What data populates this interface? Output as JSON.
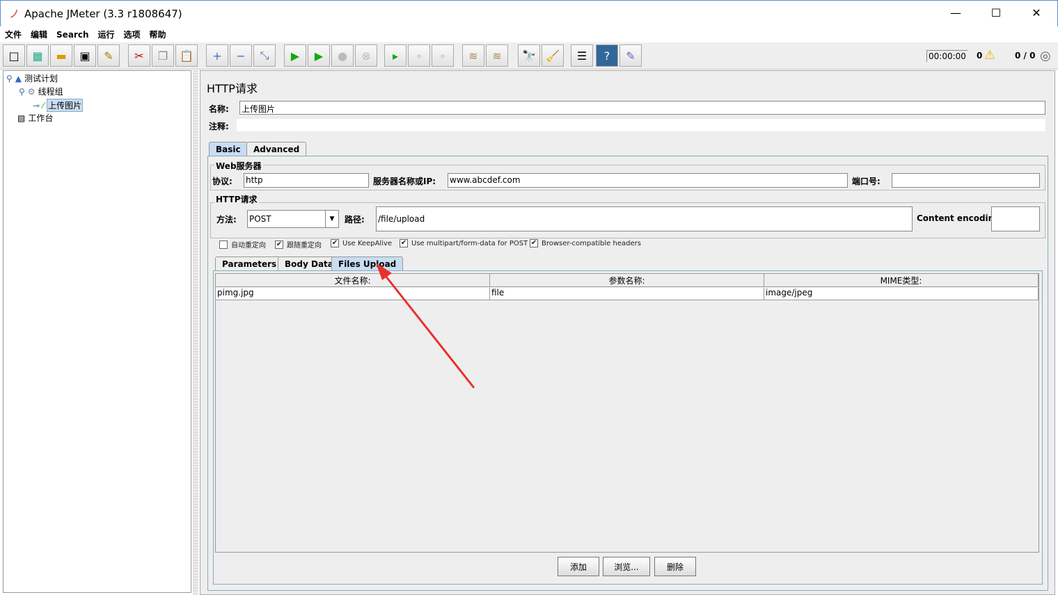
{
  "window": {
    "title": "Apache JMeter (3.3 r1808647)",
    "minimize": "—",
    "maximize": "☐",
    "close": "✕"
  },
  "menu": [
    "文件",
    "编辑",
    "Search",
    "运行",
    "选项",
    "帮助"
  ],
  "toolbar": {
    "icons": [
      "new-icon",
      "templates-icon",
      "open-icon",
      "save-icon",
      "save-as-icon",
      "cut-icon",
      "copy-icon",
      "paste-icon",
      "expand-icon",
      "collapse-icon",
      "toggle-icon",
      "start-icon",
      "start-no-pauses-icon",
      "stop-icon",
      "shutdown-icon",
      "remote-start-icon",
      "remote-stop-icon",
      "remote-exit-icon",
      "clear-icon",
      "clear-all-icon",
      "search-icon",
      "reset-search-icon",
      "function-helper-icon",
      "help-icon",
      "logger-icon"
    ],
    "timer": "00:00:00",
    "warnings": "0",
    "threads": "0 / 0"
  },
  "tree": {
    "items": [
      "测试计划",
      "线程组",
      "上传图片",
      "工作台"
    ]
  },
  "panel": {
    "title": "HTTP请求",
    "name_label": "名称:",
    "name_value": "上传图片",
    "comment_label": "注释:",
    "comment_value": "",
    "tabs": [
      "Basic",
      "Advanced"
    ],
    "web_server": {
      "legend": "Web服务器",
      "protocol_label": "协议:",
      "protocol": "http",
      "server_label": "服务器名称或IP:",
      "server": "www.abcdef.com",
      "port_label": "端口号:",
      "port": ""
    },
    "http_request": {
      "legend": "HTTP请求",
      "method_label": "方法:",
      "method": "POST",
      "path_label": "路径:",
      "path": "/file/upload",
      "encoding_label": "Content encoding:",
      "encoding": ""
    },
    "checkboxes": [
      {
        "label": "自动重定向",
        "checked": false
      },
      {
        "label": "跟随重定向",
        "checked": true
      },
      {
        "label": "Use KeepAlive",
        "checked": true
      },
      {
        "label": "Use multipart/form-data for POST",
        "checked": true
      },
      {
        "label": "Browser-compatible headers",
        "checked": true
      }
    ],
    "subtabs": [
      "Parameters",
      "Body Data",
      "Files Upload"
    ],
    "table": {
      "headers": [
        "文件名称:",
        "参数名称:",
        "MIME类型:"
      ],
      "rows": [
        [
          "pimg.jpg",
          "file",
          "image/jpeg"
        ]
      ]
    },
    "buttons": [
      "添加",
      "浏览...",
      "删除"
    ]
  },
  "annotation_color": "#e8312d"
}
